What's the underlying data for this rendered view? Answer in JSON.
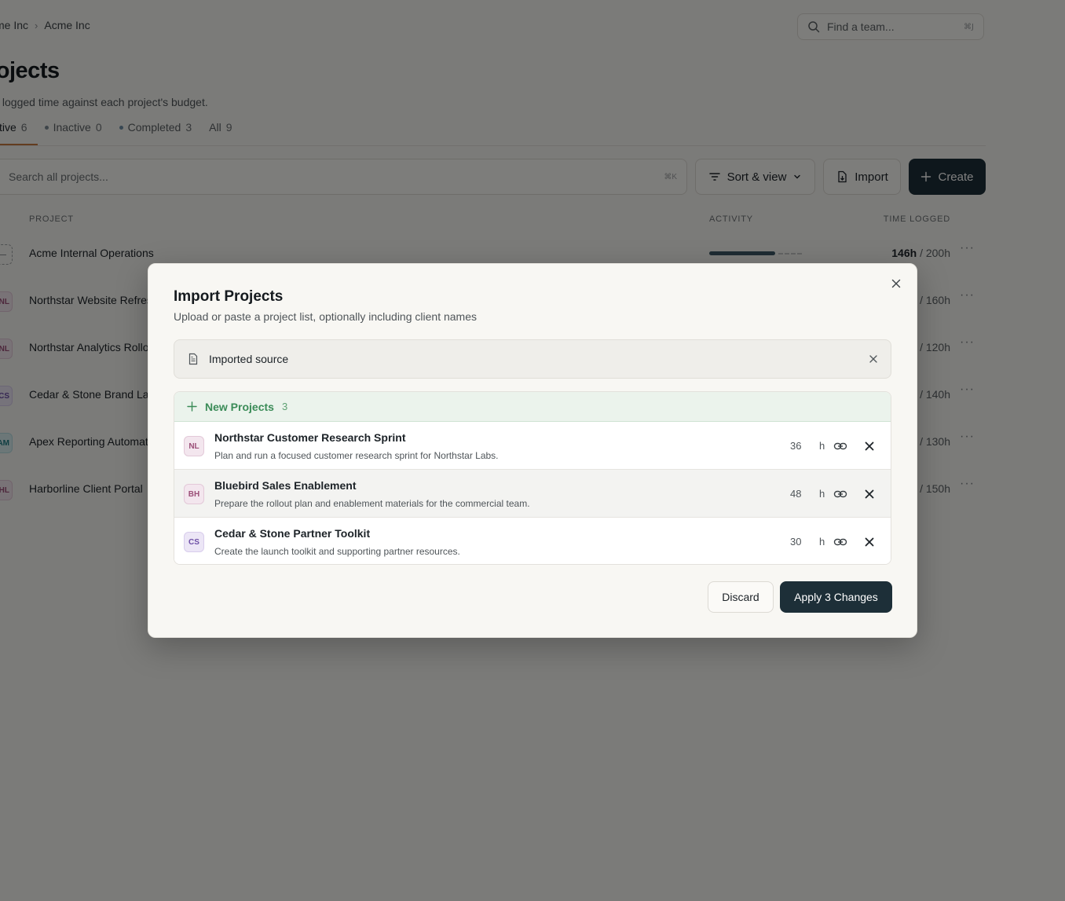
{
  "breadcrumb": [
    "me Inc",
    "Acme Inc"
  ],
  "find_team": {
    "placeholder": "Find a team...",
    "shortcut": "⌘J"
  },
  "page": {
    "title": "rojects",
    "subtitle": "k logged time against each project's budget."
  },
  "tabs": [
    {
      "label": "ctive",
      "count": "6"
    },
    {
      "label": "Inactive",
      "count": "0"
    },
    {
      "label": "Completed",
      "count": "3"
    },
    {
      "label": "All",
      "count": "9"
    }
  ],
  "search": {
    "placeholder": "Search all projects...",
    "shortcut": "⌘K"
  },
  "toolbar": {
    "sort_label": "Sort & view",
    "import_label": "Import",
    "create_label": "Create"
  },
  "table": {
    "headers": {
      "project": "PROJECT",
      "activity": "ACTIVITY",
      "time": "TIME LOGGED"
    },
    "rows": [
      {
        "badge": "—",
        "name": "Acme Internal Operations",
        "logged": "146h",
        "budget": "/ 200h",
        "activity": 0.72
      },
      {
        "badge": "NL",
        "name": "Northstar Website Refresh",
        "logged": "",
        "budget": "/ 160h"
      },
      {
        "badge": "NL",
        "name": "Northstar Analytics Rollout",
        "logged": "",
        "budget": "/ 120h"
      },
      {
        "badge": "CS",
        "name": "Cedar & Stone Brand Launch",
        "logged": "",
        "budget": "/ 140h"
      },
      {
        "badge": "AM",
        "name": "Apex Reporting Automation",
        "logged": "",
        "budget": "/ 130h"
      },
      {
        "badge": "HL",
        "name": "Harborline Client Portal",
        "logged": "",
        "budget": "/ 150h"
      }
    ]
  },
  "modal": {
    "title": "Import Projects",
    "subtitle": "Upload or paste a project list, optionally including client names",
    "source_label": "Imported source",
    "new_projects_label": "New Projects",
    "new_projects_count": "3",
    "items": [
      {
        "badge": "NL",
        "name": "Northstar Customer Research Sprint",
        "desc": "Plan and run a focused customer research sprint for Northstar Labs.",
        "hours": "36",
        "unit": "h"
      },
      {
        "badge": "BH",
        "name": "Bluebird Sales Enablement",
        "desc": "Prepare the rollout plan and enablement materials for the commercial team.",
        "hours": "48",
        "unit": "h"
      },
      {
        "badge": "CS",
        "name": "Cedar & Stone Partner Toolkit",
        "desc": "Create the launch toolkit and supporting partner resources.",
        "hours": "30",
        "unit": "h"
      }
    ],
    "discard_label": "Discard",
    "apply_label": "Apply 3 Changes"
  },
  "colors": {
    "accent_dark": "#1d2f38",
    "tab_underline": "#c7793f",
    "new_projects_green": "#3b8c58",
    "overlay": "rgba(0,0,0,0.5)"
  },
  "icons": [
    "search-icon",
    "chevron-right-icon",
    "filter-icon",
    "chevron-down-icon",
    "file-import-icon",
    "plus-icon",
    "more-icon",
    "close-icon",
    "document-icon",
    "link-icon"
  ]
}
